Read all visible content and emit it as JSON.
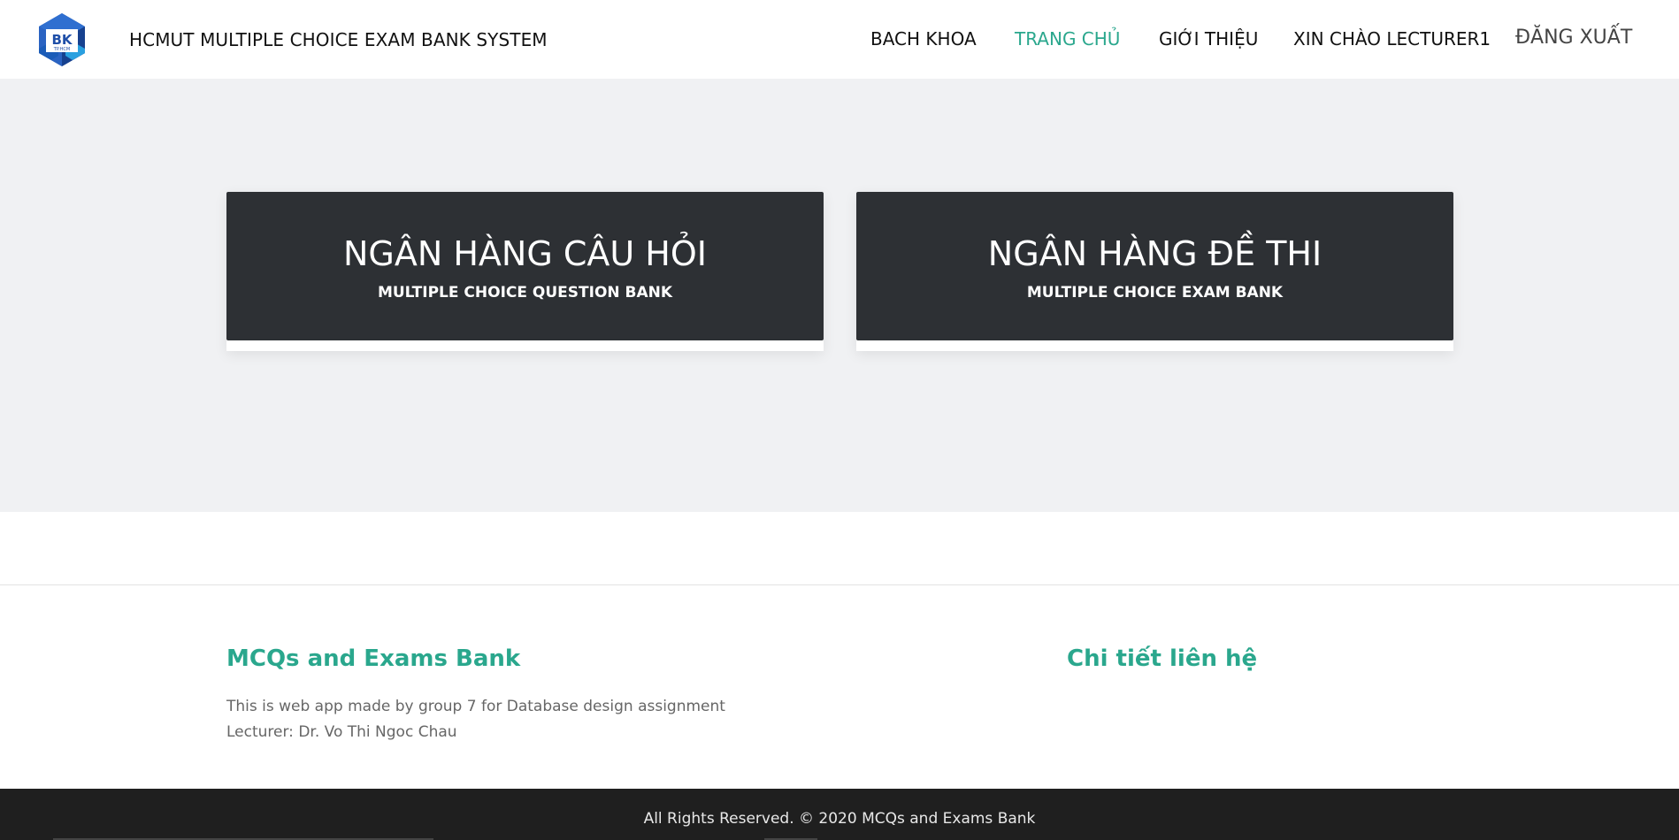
{
  "header": {
    "logo_text": "BK",
    "logo_subtext": "TP.HCM",
    "site_title": "HCMUT MULTIPLE CHOICE EXAM BANK SYSTEM",
    "nav": {
      "bach_khoa": "BACH KHOA",
      "home": "TRANG CHỦ",
      "about": "GIỚI THIỆU",
      "greeting": "XIN CHÀO LECTURER1",
      "logout": "ĐĂNG XUẤT"
    }
  },
  "cards": {
    "question_bank": {
      "title": "NGÂN HÀNG CÂU HỎI",
      "subtitle": "MULTIPLE CHOICE QUESTION BANK"
    },
    "exam_bank": {
      "title": "NGÂN HÀNG ĐỀ THI",
      "subtitle": "MULTIPLE CHOICE EXAM BANK"
    }
  },
  "footer": {
    "about_heading": "MCQs and Exams Bank",
    "about_line1": "This is web app made by group 7 for Database design assignment",
    "about_line2": "Lecturer: Dr. Vo Thi Ngoc Chau",
    "contact_heading": "Chi tiết liên hệ",
    "copyright": "All Rights Reserved. © 2020 MCQs and Exams Bank"
  },
  "colors": {
    "accent": "#2aa78d",
    "card_bg": "#2d3034",
    "hero_bg": "#f0f1f3",
    "bottom_bar": "#1f1f1f",
    "logo_blue": "#1f4fa8"
  }
}
